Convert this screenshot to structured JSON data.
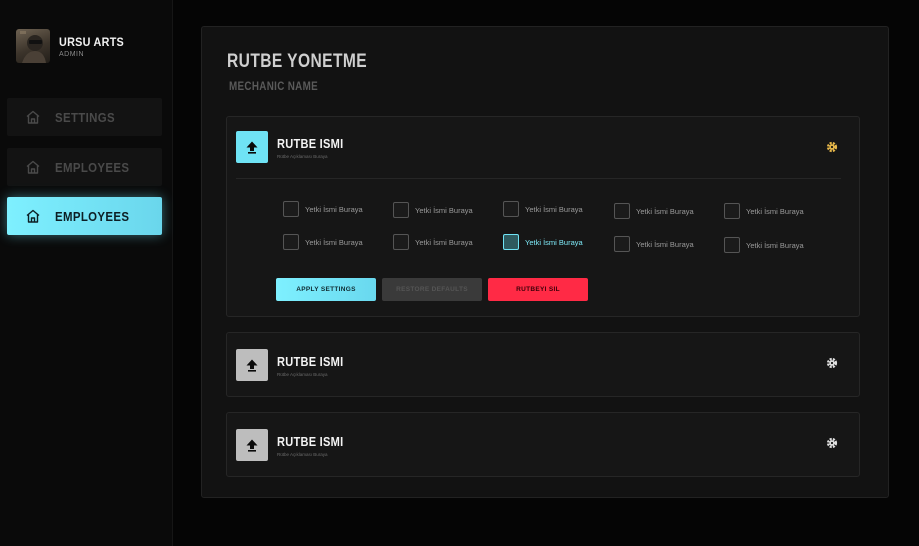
{
  "profile": {
    "name": "URSU ARTS",
    "role": "ADMIN"
  },
  "sidebar": {
    "items": [
      {
        "label": "SETTINGS",
        "icon": "home-icon",
        "active": false
      },
      {
        "label": "EMPLOYEES",
        "icon": "home-icon",
        "active": false
      },
      {
        "label": "EMPLOYEES",
        "icon": "home-icon",
        "active": true
      }
    ]
  },
  "panel": {
    "title": "RUTBE YONETME",
    "subtitle": "MECHANIC NAME"
  },
  "ranks": [
    {
      "name": "RUTBE ISMI",
      "description": "Rütbe Açıklaması Buraya",
      "expanded": true,
      "active": true,
      "gear_color": "#e8b84a",
      "permissions": [
        {
          "label": "Yetki İsmi Buraya",
          "checked": false
        },
        {
          "label": "Yetki İsmi Buraya",
          "checked": false
        },
        {
          "label": "Yetki İsmi Buraya",
          "checked": false
        },
        {
          "label": "Yetki İsmi Buraya",
          "checked": false
        },
        {
          "label": "Yetki İsmi Buraya",
          "checked": false
        },
        {
          "label": "Yetki İsmi Buraya",
          "checked": false
        },
        {
          "label": "Yetki İsmi Buraya",
          "checked": false
        },
        {
          "label": "Yetki İsmi Buraya",
          "checked": true
        },
        {
          "label": "Yetki İsmi Buraya",
          "checked": false
        },
        {
          "label": "Yetki İsmi Buraya",
          "checked": false
        }
      ],
      "buttons": {
        "apply": "APPLY SETTINGS",
        "reset": "RESTORE DEFAULTS",
        "delete": "RUTBEYI SIL"
      }
    },
    {
      "name": "RUTBE ISMI",
      "description": "Rütbe Açıklaması Buraya",
      "expanded": false,
      "active": false,
      "gear_color": "#e0e0e0"
    },
    {
      "name": "RUTBE ISMI",
      "description": "Rütbe Açıklaması Buraya",
      "expanded": false,
      "active": false,
      "gear_color": "#e0e0e0"
    }
  ],
  "colors": {
    "accent": "#6fe3f5",
    "danger": "#ff2a45",
    "background": "#050505",
    "panel": "#121212"
  }
}
